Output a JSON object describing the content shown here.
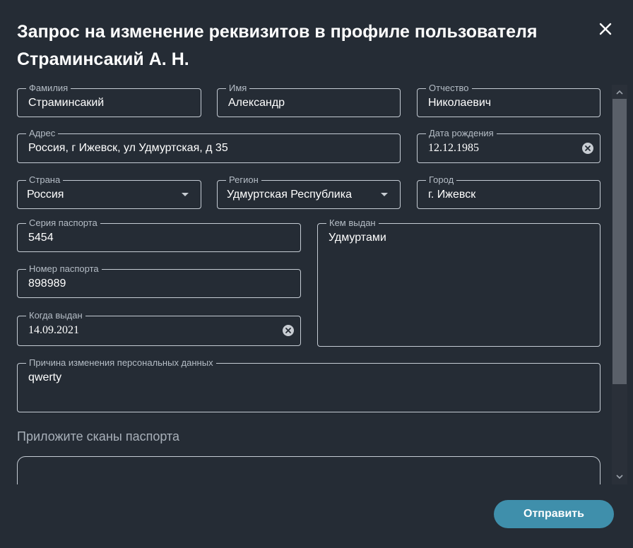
{
  "dialog": {
    "title": "Запрос на изменение реквизитов в профиле пользователя Страминсакий А. Н."
  },
  "fields": {
    "last_name": {
      "label": "Фамилия",
      "value": "Страминсакий"
    },
    "first_name": {
      "label": "Имя",
      "value": "Александр"
    },
    "patronymic": {
      "label": "Отчество",
      "value": "Николаевич"
    },
    "address": {
      "label": "Адрес",
      "value": "Россия, г Ижевск, ул Удмуртская, д 35"
    },
    "birth_date": {
      "label": "Дата рождения",
      "value": "12.12.1985"
    },
    "country": {
      "label": "Страна",
      "value": "Россия"
    },
    "region": {
      "label": "Регион",
      "value": "Удмуртская Республика"
    },
    "city": {
      "label": "Город",
      "value": "г. Ижевск"
    },
    "passport_series": {
      "label": "Серия паспорта",
      "value": "5454"
    },
    "passport_number": {
      "label": "Номер паспорта",
      "value": "898989"
    },
    "issue_date": {
      "label": "Когда выдан",
      "value": "14.09.2021"
    },
    "issued_by": {
      "label": "Кем выдан",
      "value": "Удмуртами"
    },
    "change_reason": {
      "label": "Причина изменения персональных данных",
      "value": "qwerty"
    }
  },
  "attachments": {
    "title": "Приложите сканы паспорта"
  },
  "actions": {
    "submit_label": "Отправить"
  },
  "colors": {
    "background": "#252c35",
    "border": "#c5ccd4",
    "label": "#b5bdc6",
    "accent": "#3f8fab"
  }
}
